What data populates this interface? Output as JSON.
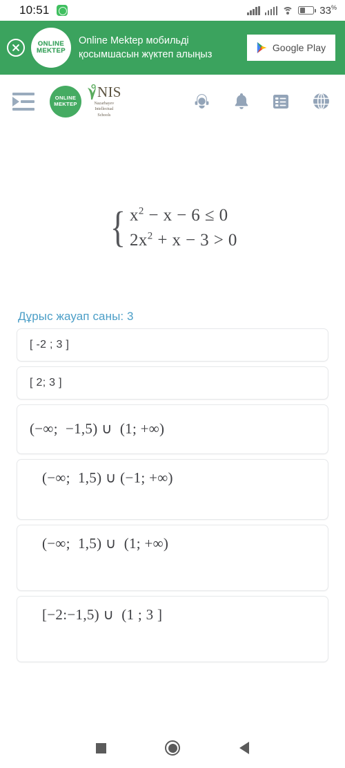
{
  "status_bar": {
    "time": "10:51",
    "app_icon": "whatsapp-icon",
    "signal_1": "signal-bars-icon",
    "signal_2": "signal-bars-icon",
    "wifi": "wifi-icon",
    "battery": "battery-icon",
    "battery_level": "33",
    "battery_unit": "%"
  },
  "promo_banner": {
    "close_icon": "close-circle-icon",
    "logo_line1": "ONLINE",
    "logo_line2": "MEKTEP",
    "text": "Online Mektep мобильді қосымшасын жүктеп алыңыз",
    "cta_label": "Google Play",
    "cta_icon": "google-play-icon",
    "background_color": "#3ba35e"
  },
  "navbar": {
    "menu_icon": "menu-indent-icon",
    "brand_logo_line1": "ONLINE",
    "brand_logo_line2": "MEKTEP",
    "nis_word": "NIS",
    "nis_sub_line1": "Nazarbayev",
    "nis_sub_line2": "Intellectual",
    "nis_sub_line3": "Schools",
    "icons": [
      {
        "name": "support-agent-icon"
      },
      {
        "name": "bell-icon"
      },
      {
        "name": "list-icon"
      },
      {
        "name": "globe-icon"
      }
    ]
  },
  "question": {
    "brace": "{",
    "line1_pre": "x",
    "line1_sup": "2",
    "line1_post": " − x − 6 ≤ 0",
    "line2_pre": "2x",
    "line2_sup": "2",
    "line2_post": " + x − 3 > 0",
    "full_text": "{ x² − x − 6 ≤ 0 ; 2x² + x − 3 > 0 }"
  },
  "answers": {
    "count_label": "Дұрыс жауап саны: 3",
    "count_color": "#4b9ec7",
    "options": [
      {
        "text": "[ -2 ; 3 ]",
        "size": "h-sm",
        "indent": ""
      },
      {
        "text": "[ 2; 3 ]",
        "size": "h-sm",
        "indent": ""
      },
      {
        "text": "(−∞;  −1,5) ∪  (1; +∞)",
        "size": "h-md",
        "indent": ""
      },
      {
        "text": "(−∞;  1,5) ∪ (−1; +∞)",
        "size": "h-lg",
        "indent": "indent-1"
      },
      {
        "text": "(−∞;  1,5) ∪  (1; +∞)",
        "size": "h-xl",
        "indent": "indent-1"
      },
      {
        "text": "[−2:−1,5) ∪  (1 ; 3 ]",
        "size": "h-xl",
        "indent": "indent-1"
      }
    ]
  },
  "system_nav": {
    "recents": "square-recents-icon",
    "home": "circle-home-icon",
    "back": "triangle-back-icon"
  }
}
